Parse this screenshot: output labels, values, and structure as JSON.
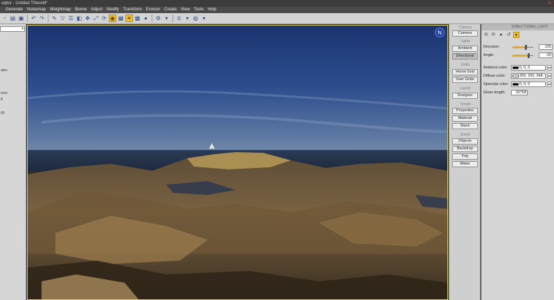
{
  "window": {
    "title": "ulptor - Untitled TSworld*"
  },
  "menu": [
    "Generate",
    "Noisemap",
    "Weightmap",
    "Biome",
    "Adjust",
    "Modify",
    "Transform",
    "Erosion",
    "Create",
    "View",
    "Tools",
    "Help"
  ],
  "toolbar": {
    "icons": [
      "new-icon",
      "open-icon",
      "save-icon",
      "undo-icon",
      "redo-icon",
      "brush-icon",
      "filter-icon",
      "layers-icon",
      "render-icon",
      "move-icon",
      "scale-icon",
      "rotate-icon",
      "camera-icon",
      "sun-icon",
      "view-icon",
      "grid-icon",
      "sphere-icon"
    ]
  },
  "left_panel": {
    "labels": [
      "ates",
      "rees",
      "8",
      "00"
    ]
  },
  "viewport": {
    "compass_label": "N"
  },
  "button_column": {
    "groups": [
      {
        "label": "Camera",
        "buttons": [
          "Camera"
        ]
      },
      {
        "label": "Lights",
        "buttons": [
          "Ambient",
          "Directional"
        ]
      },
      {
        "label": "Grids",
        "buttons": [
          "Home Grid",
          "User Grids"
        ]
      },
      {
        "label": "Layout",
        "buttons": [
          "Designer"
        ]
      },
      {
        "label": "Terrain",
        "buttons": [
          "Properties",
          "Material",
          "Stack"
        ]
      },
      {
        "label": "Scene",
        "buttons": [
          "Objects",
          "Backdrop",
          "Fog",
          "Water"
        ]
      }
    ],
    "selected": "Directional"
  },
  "right_panel": {
    "header": "DIRECTIONAL LIGHT",
    "direction": {
      "label": "Direction:",
      "value": "225",
      "fraction": 0.62
    },
    "angle": {
      "label": "Angle:",
      "value": "-20",
      "fraction": 0.78
    },
    "ambient_color": {
      "label": "Ambient color:",
      "value": "0, 0, 0",
      "swatch": "#000000"
    },
    "diffuse_color": {
      "label": "Diffuse color:",
      "value": "255, 255, 248",
      "swatch": "#fffff8"
    },
    "specular_color": {
      "label": "Specular color:",
      "value": "0, 0, 0",
      "swatch": "#000000"
    },
    "gloss_length": {
      "label": "Gloss length:",
      "value": "32768"
    }
  },
  "colors": {
    "accent": "#f2c230",
    "sky_top": "#1c3676",
    "sky_horizon": "#6d86a8",
    "terrain": "#8a7148"
  }
}
